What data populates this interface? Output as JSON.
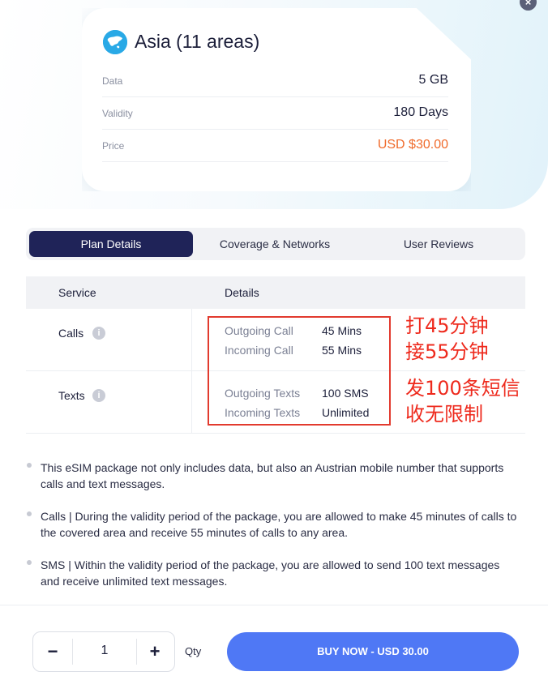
{
  "card": {
    "title": "Asia (11 areas)",
    "rows": [
      {
        "label": "Data",
        "value": "5 GB"
      },
      {
        "label": "Validity",
        "value": "180 Days"
      },
      {
        "label": "Price",
        "value": "USD $30.00"
      }
    ]
  },
  "close_icon": "×",
  "tabs": [
    "Plan Details",
    "Coverage & Networks",
    "User Reviews"
  ],
  "table": {
    "headers": {
      "service": "Service",
      "details": "Details"
    },
    "rows": [
      {
        "service": "Calls",
        "details": [
          {
            "label": "Outgoing Call",
            "value": "45 Mins"
          },
          {
            "label": "Incoming Call",
            "value": "55 Mins"
          }
        ]
      },
      {
        "service": "Texts",
        "details": [
          {
            "label": "Outgoing Texts",
            "value": "100 SMS"
          },
          {
            "label": "Incoming Texts",
            "value": "Unlimited"
          }
        ]
      }
    ],
    "info_icon": "i"
  },
  "annotations": {
    "calls": [
      "打45分钟",
      "接55分钟"
    ],
    "texts": [
      "发100条短信",
      "收无限制"
    ],
    "color": "#ee2a1d"
  },
  "notes": [
    "This eSIM package not only includes data, but also an Austrian mobile number that supports calls and text messages.",
    "Calls | During the validity period of the package, you are allowed to make 45 minutes of calls to the covered area and receive 55 minutes of calls to any area.",
    "SMS | Within the validity period of the package, you are allowed to send 100 text messages and receive unlimited text messages."
  ],
  "footer": {
    "minus": "−",
    "quantity": "1",
    "plus": "+",
    "qty_label": "Qty",
    "buy_label": "BUY NOW - USD 30.00"
  },
  "colors": {
    "accent": "#4f78f5",
    "active_tab": "#1f2358",
    "price": "#f06b2c"
  }
}
